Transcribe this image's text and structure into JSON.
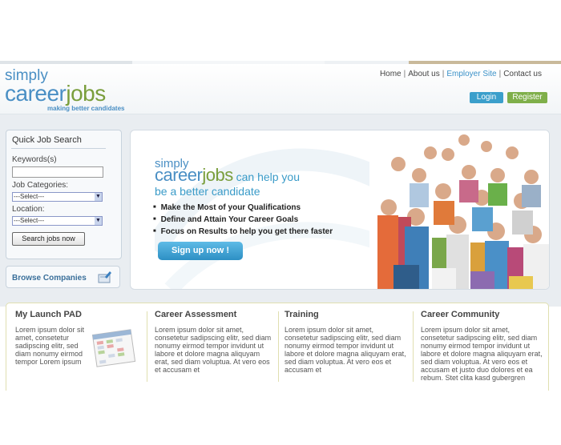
{
  "logo": {
    "line1": "simply",
    "line2a": "career",
    "line2b": "jobs",
    "tagline": "making better candidates"
  },
  "nav": {
    "home": "Home",
    "about": "About us",
    "employer": "Employer Site",
    "contact": "Contact us",
    "sep": "|"
  },
  "auth": {
    "login": "Login",
    "register": "Register"
  },
  "quick_search": {
    "title": "Quick Job Search",
    "keywords_label": "Keywords(s)",
    "keywords_value": "",
    "categories_label": "Job Categories:",
    "categories_selected": "---Select---",
    "location_label": "Location:",
    "location_selected": "---Select---",
    "search_button": "Search jobs now"
  },
  "browse": {
    "label": "Browse Companies"
  },
  "hero": {
    "line1": "simply",
    "line2a": "career",
    "line2b": "jobs",
    "line2c": " can help you",
    "line3": "be a better candidate",
    "bullets": [
      "Make the Most of your Qualifications",
      "Define and Attain Your Career Goals",
      "Focus on Results to help you get there faster"
    ],
    "signup": "Sign up now !"
  },
  "columns": [
    {
      "title": "My Launch PAD",
      "body": "Lorem ipsum dolor sit amet, consetetur sadipscing elitr, sed diam nonumy eirmod tempor Lorem ipsum"
    },
    {
      "title": "Career Assessment",
      "body": "Lorem ipsum dolor sit amet, consetetur sadipscing elitr, sed diam nonumy eirmod tempor invidunt ut labore et dolore magna aliquyam erat, sed diam voluptua. At vero eos et accusam et"
    },
    {
      "title": "Training",
      "body": "Lorem ipsum dolor sit amet, consetetur sadipscing elitr, sed diam nonumy eirmod tempor invidunt ut labore et dolore magna aliquyam erat, sed diam voluptua. At vero eos et accusam et"
    },
    {
      "title": "Career Community",
      "body": "Lorem ipsum dolor sit amet, consetetur sadipscing elitr, sed diam nonumy eirmod tempor invidunt ut labore et dolore magna aliquyam erat, sed diam voluptua. At vero eos et accusam et justo duo dolores et ea rebum. Stet clita kasd gubergren"
    }
  ],
  "colors": {
    "brand_blue": "#4a8fc4",
    "brand_green": "#7a9e3c",
    "login_bg": "#3b9fcb",
    "register_bg": "#7faf4a"
  },
  "icons": [
    "browse-companies-icon",
    "calendar-icon",
    "crowd-photo"
  ]
}
